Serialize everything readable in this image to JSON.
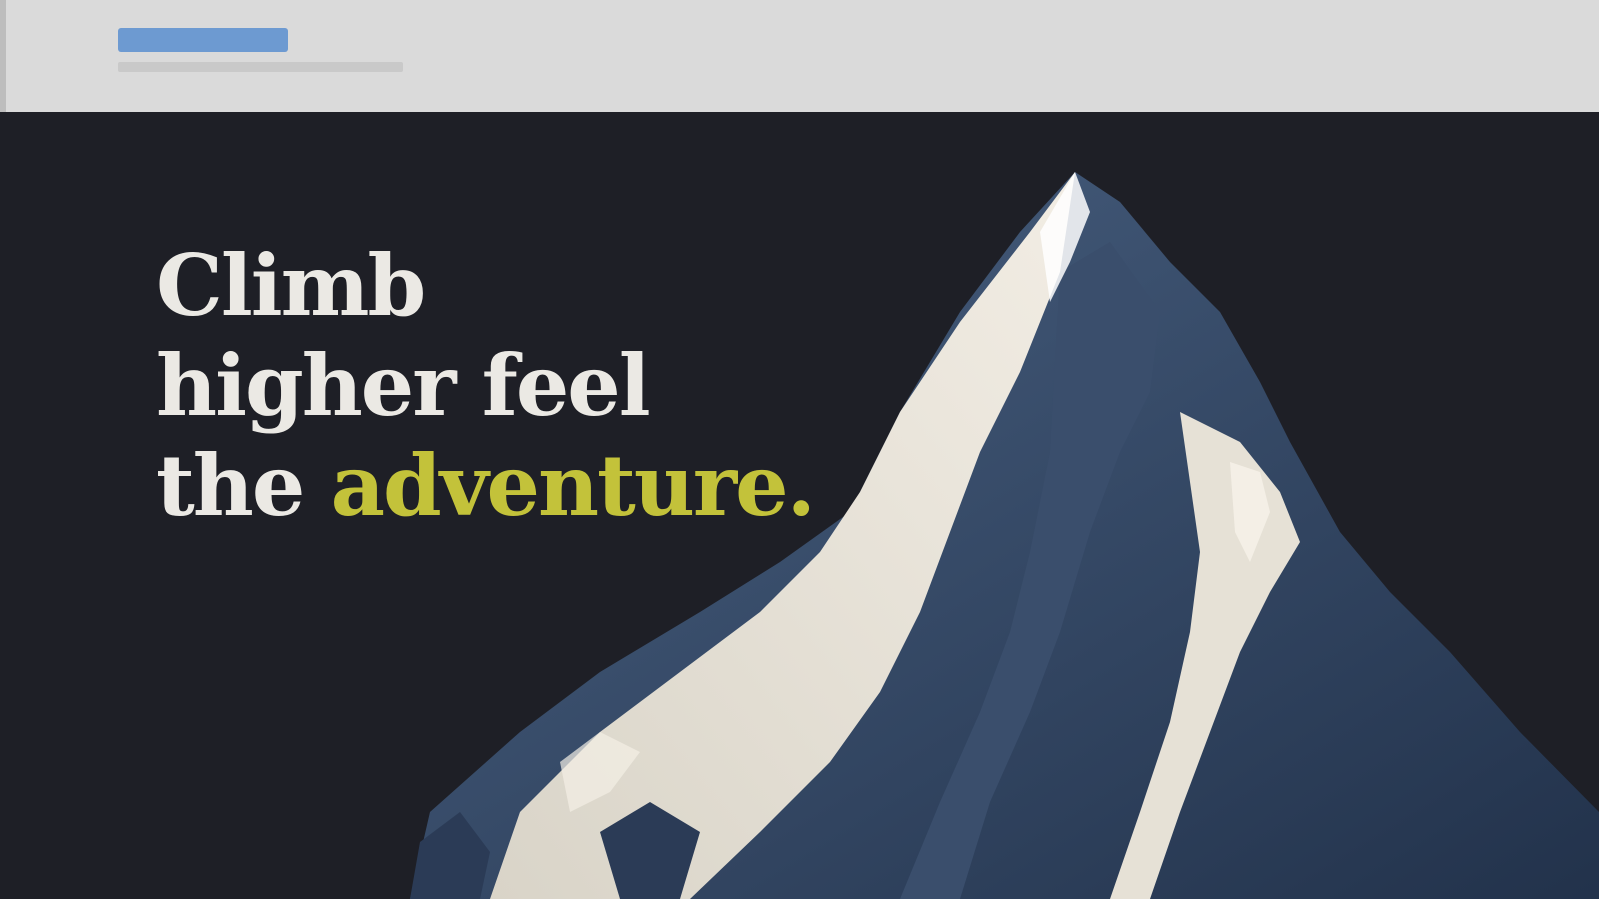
{
  "header": {
    "logo_text": "",
    "tagline": ""
  },
  "hero": {
    "headline_line1": "Climb",
    "headline_line2": "higher feel",
    "headline_line3_prefix": "the ",
    "headline_accent": "adventure.",
    "image": "snow-capped mountain peak",
    "colors": {
      "background": "#1e1f26",
      "headline": "#ebe9e4",
      "accent": "#c3c23a",
      "header_bg": "#dadada",
      "logo": "#6d9ad1"
    }
  }
}
